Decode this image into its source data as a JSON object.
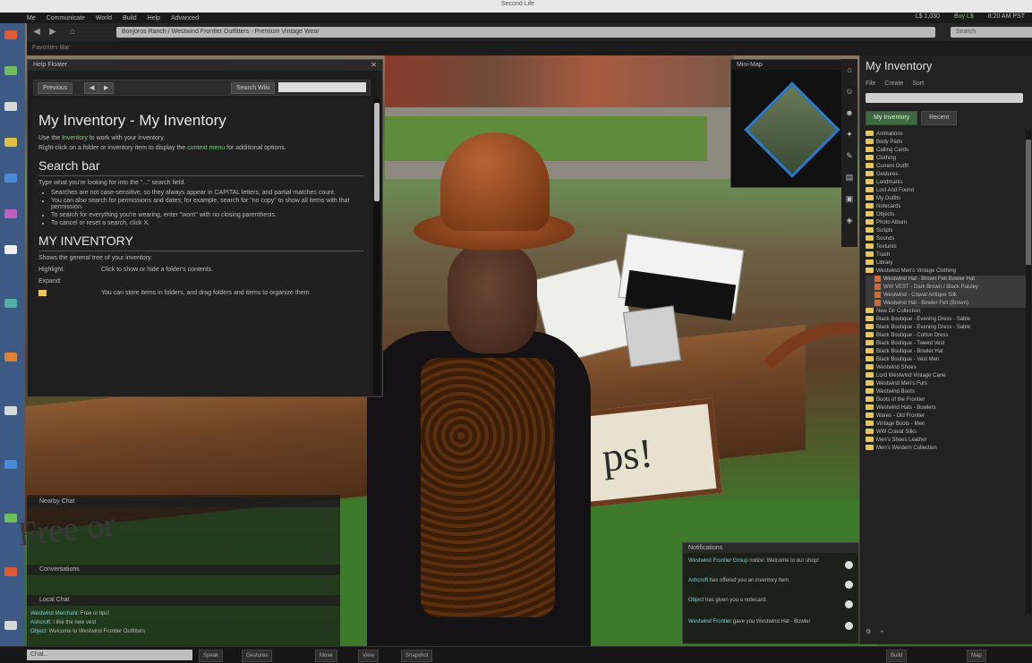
{
  "window": {
    "title": "Second Life"
  },
  "app_menu": [
    "Me",
    "Communicate",
    "World",
    "Build",
    "Help",
    "Advanced"
  ],
  "status": {
    "balance": "L$ 1,030",
    "buy": "Buy L$",
    "time": "8:20 AM PST"
  },
  "nav": {
    "url": "Bonjoros Ranch / Westwind Frontier Outfitters - Premium Vintage Wear",
    "search_placeholder": "Search"
  },
  "favorites_label": "Favorites Bar",
  "help": {
    "title": "Help Floater",
    "back_label": "Previous",
    "search_label": "Search Wiki",
    "heading": "My Inventory - My Inventory",
    "p1_pre": "Use the",
    "p1_link": "Inventory",
    "p1_post": "to work with your inventory.",
    "p2_pre": "Right-click on a folder or inventory item to display the",
    "p2_link": "context menu",
    "p2_post": "for additional options.",
    "section1": "Search bar",
    "s1_text": "Type what you're looking for into the \"...\" search field.",
    "bullets": [
      "Searches are not case-sensitive, so they always appear in CAPITAL letters, and partial matches count.",
      "You can also search for permissions and dates; for example, search for \"no copy\" to show all items with that permission.",
      "To search for everything you're wearing, enter \"worn\" with no closing parenthesis.",
      "To cancel or reset a search, click X."
    ],
    "section2": "MY INVENTORY",
    "s2_text": "Shows the general tree of your inventory.",
    "row1_key": "Highlight:",
    "row1_val": "Click to show or hide a folder's contents.",
    "row2_key": "Expand:",
    "row3_val": "You can store items in folders, and drag folders and items to organize them."
  },
  "minimap": {
    "title": "Mini-Map"
  },
  "inventory": {
    "title": "My Inventory",
    "menu": [
      "File",
      "Create",
      "Sort"
    ],
    "tabs": [
      "My Inventory",
      "Recent"
    ],
    "items": [
      {
        "type": "folder",
        "label": "Animations"
      },
      {
        "type": "folder",
        "label": "Body Parts"
      },
      {
        "type": "folder",
        "label": "Calling Cards"
      },
      {
        "type": "folder",
        "label": "Clothing"
      },
      {
        "type": "folder",
        "label": "Current Outfit"
      },
      {
        "type": "folder",
        "label": "Gestures"
      },
      {
        "type": "folder",
        "label": "Landmarks"
      },
      {
        "type": "folder",
        "label": "Lost And Found"
      },
      {
        "type": "folder",
        "label": "My Outfits"
      },
      {
        "type": "folder",
        "label": "Notecards"
      },
      {
        "type": "folder",
        "label": "Objects"
      },
      {
        "type": "folder",
        "label": "Photo Album"
      },
      {
        "type": "folder",
        "label": "Scripts"
      },
      {
        "type": "folder",
        "label": "Sounds"
      },
      {
        "type": "folder",
        "label": "Textures"
      },
      {
        "type": "folder",
        "label": "Trash"
      },
      {
        "type": "folder",
        "label": "Library"
      },
      {
        "type": "folder",
        "label": "Westwind Men's Vintage Clothing"
      },
      {
        "type": "object",
        "label": "Westwind Hat - Brown Felt Bowler Hat"
      },
      {
        "type": "object",
        "label": "WW VEST - Dark Brown / Black Paisley"
      },
      {
        "type": "object",
        "label": "Westwind - Cravat Antique Silk"
      },
      {
        "type": "object",
        "label": "Westwind Hat - Bowler Felt (Brown)"
      },
      {
        "type": "folder",
        "label": "New Dir Collection"
      },
      {
        "type": "folder",
        "label": "Black Boutique - Evening Dress - Sable"
      },
      {
        "type": "folder",
        "label": "Black Boutique - Evening Dress - Sable"
      },
      {
        "type": "folder",
        "label": "Black Boutique - Cotton Dress"
      },
      {
        "type": "folder",
        "label": "Black Boutique - Tweed Vest"
      },
      {
        "type": "folder",
        "label": "Black Boutique - Bowler Hat"
      },
      {
        "type": "folder",
        "label": "Black Boutique - Vest Men"
      },
      {
        "type": "folder",
        "label": "Westwind Shoes"
      },
      {
        "type": "folder",
        "label": "Lord Westwind Vintage Cane"
      },
      {
        "type": "folder",
        "label": "Westwind Men's Furs"
      },
      {
        "type": "folder",
        "label": "Westwind Boots"
      },
      {
        "type": "folder",
        "label": "Boots of the Frontier"
      },
      {
        "type": "folder",
        "label": "Westwind Hats - Bowlers"
      },
      {
        "type": "folder",
        "label": "Wares - Old Frontier"
      },
      {
        "type": "folder",
        "label": "Vintage Boots - Men"
      },
      {
        "type": "folder",
        "label": "WW Cravat Silks"
      },
      {
        "type": "folder",
        "label": "Men's Shoes Leather"
      },
      {
        "type": "folder",
        "label": "Men's Western Collection"
      }
    ],
    "bottom_gear": "⚙",
    "bottom_add": "+"
  },
  "chat": {
    "rows": [
      "Nearby Chat",
      "Conversations",
      "Local Chat"
    ],
    "lines": [
      {
        "name": "Westwind Merchant:",
        "text": " Free or tips!"
      },
      {
        "name": "Ashcroft:",
        "text": " I like the new vest"
      },
      {
        "name": "Object:",
        "text": " Welcome to Westwind Frontier Outfitters"
      }
    ],
    "ghost_text": "Free or"
  },
  "sign_text": "ps!",
  "notifications": {
    "title": "Notifications",
    "items": [
      {
        "link": "Westwind Frontier Group",
        "text": " notice: Welcome to our shop!"
      },
      {
        "link": "Ashcroft",
        "text": " has offered you an inventory item."
      },
      {
        "link": "Object",
        "text": " has given you a notecard."
      },
      {
        "link": "Westwind Frontier",
        "text": " gave you Westwind Hat - Bowler"
      }
    ]
  },
  "bottom": {
    "chat_placeholder": "Chat...",
    "buttons": [
      "Speak",
      "Gestures",
      "Move",
      "View",
      "Snapshot"
    ],
    "right_buttons": [
      "Build",
      "Map"
    ]
  },
  "colors": {
    "accent": "#3d6b3d",
    "link": "#7ecf7e",
    "folder": "#e8c65a",
    "object": "#d06a30"
  }
}
